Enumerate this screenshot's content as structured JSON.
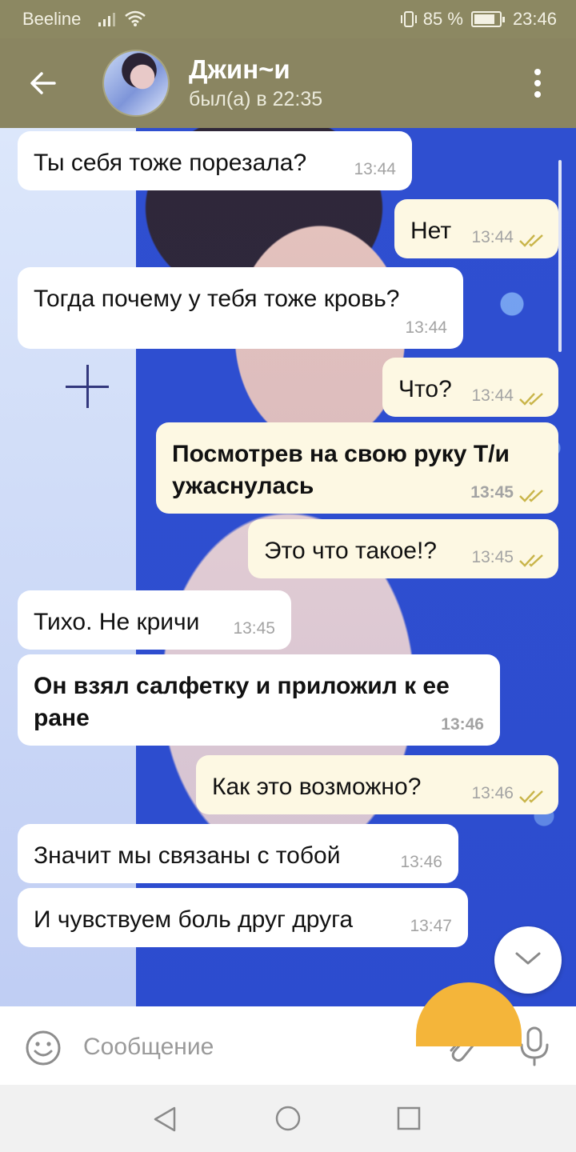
{
  "status": {
    "carrier": "Beeline",
    "battery": "85 %",
    "time": "23:46",
    "battery_level": 0.85
  },
  "header": {
    "name": "Джин~и",
    "last_seen": "был(а) в 22:35"
  },
  "messages": [
    {
      "dir": "in",
      "text": "Ты себя тоже порезала?",
      "time": "13:44"
    },
    {
      "dir": "out",
      "text": "Нет",
      "time": "13:44"
    },
    {
      "dir": "in",
      "text": "Тогда почему у тебя тоже кровь?",
      "time": "13:44"
    },
    {
      "dir": "out",
      "text": "Что?",
      "time": "13:44"
    },
    {
      "dir": "out",
      "text": "Посмотрев на свою руку Т/и ужаснулась",
      "time": "13:45",
      "bold": true
    },
    {
      "dir": "out",
      "text": "Это что такое!?",
      "time": "13:45"
    },
    {
      "dir": "in",
      "text": "Тихо. Не кричи",
      "time": "13:45"
    },
    {
      "dir": "in",
      "text": "Он взял салфетку и приложил к ее ране",
      "time": "13:46",
      "bold": true
    },
    {
      "dir": "out",
      "text": "Как это возможно?",
      "time": "13:46"
    },
    {
      "dir": "in",
      "text": "Значит мы связаны с тобой",
      "time": "13:46"
    },
    {
      "dir": "in",
      "text": "И чувствуем боль друг друга",
      "time": "13:47"
    }
  ],
  "input": {
    "placeholder": "Сообщение"
  },
  "icons": {
    "back": "arrow-left-icon",
    "menu": "more-vert-icon",
    "scroll": "chevron-down-icon",
    "emoji": "smile-icon",
    "attach": "paperclip-icon",
    "mic": "microphone-icon",
    "read": "double-check-icon"
  },
  "colors": {
    "header": "#8a8561",
    "outgoing": "#fdf8e3",
    "incoming": "#ffffff",
    "ticks": "#c9b54a"
  }
}
